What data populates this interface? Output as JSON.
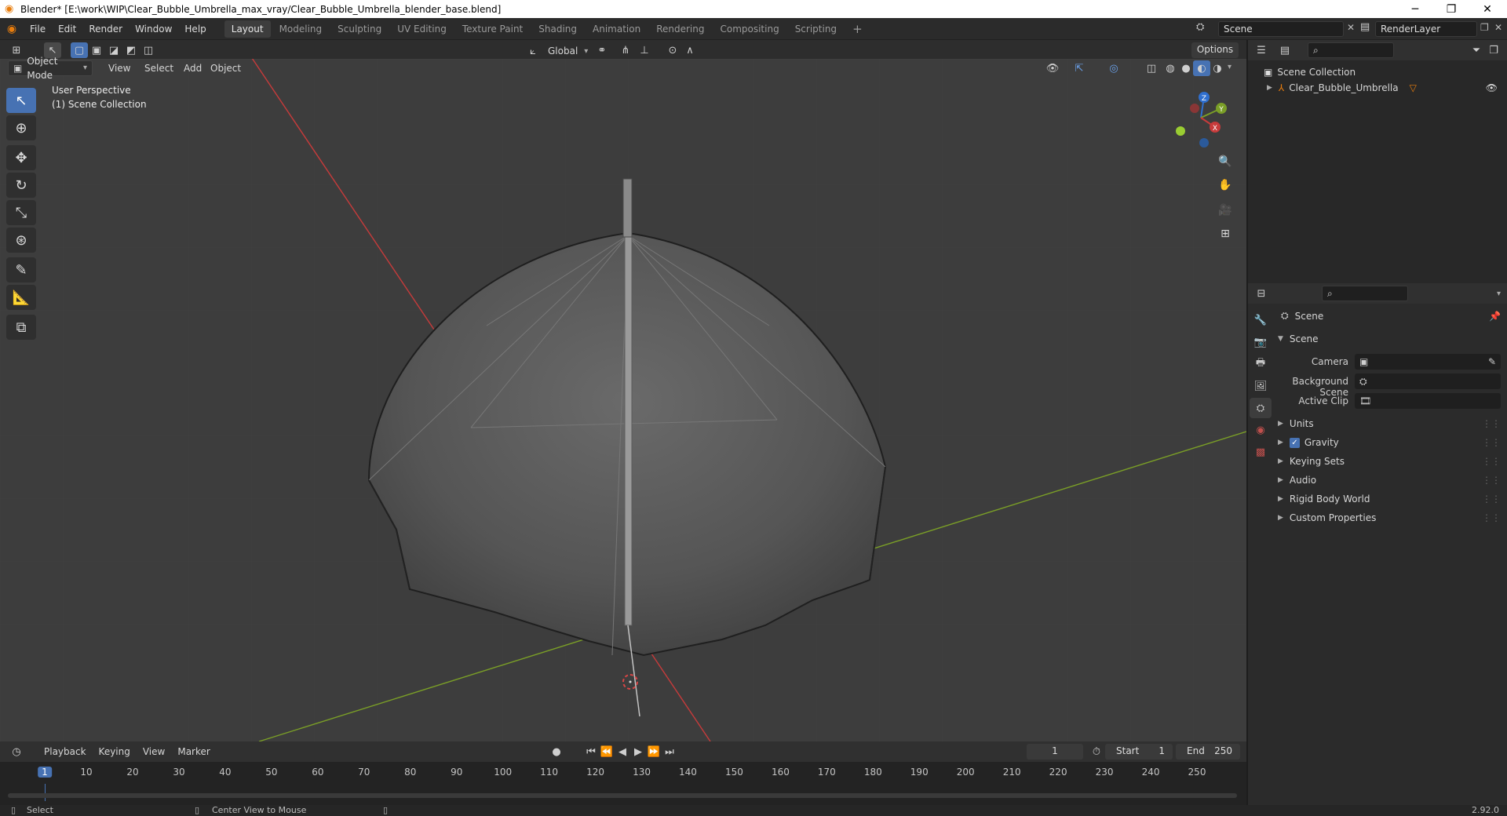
{
  "window": {
    "title": "Blender* [E:\\work\\WIP\\Clear_Bubble_Umbrella_max_vray/Clear_Bubble_Umbrella_blender_base.blend]",
    "minimize": "─",
    "maximize": "❐",
    "close": "✕"
  },
  "menu": {
    "items": [
      "File",
      "Edit",
      "Render",
      "Window",
      "Help"
    ],
    "workspaces": [
      "Layout",
      "Modeling",
      "Sculpting",
      "UV Editing",
      "Texture Paint",
      "Shading",
      "Animation",
      "Rendering",
      "Compositing",
      "Scripting"
    ],
    "add_workspace": "+",
    "scene_value": "Scene",
    "render_layer_value": "RenderLayer"
  },
  "viewport_header": {
    "mode": "Object Mode",
    "menus": [
      "View",
      "Select",
      "Add",
      "Object"
    ],
    "orientation": "Global",
    "options": "Options"
  },
  "viewport": {
    "perspective": "User Perspective",
    "collection": "(1) Scene Collection",
    "gizmo_axes": {
      "x": "X",
      "y": "Y",
      "z": "Z"
    },
    "axis_colors": {
      "x": "#c73b3b",
      "y": "#7a9e27",
      "z": "#2f6fcf"
    }
  },
  "outliner": {
    "root": "Scene Collection",
    "item": "Clear_Bubble_Umbrella"
  },
  "properties": {
    "context": "Scene",
    "panel": "Scene",
    "camera_label": "Camera",
    "background_scene_label": "Background Scene",
    "active_clip_label": "Active Clip",
    "sections": [
      "Units",
      "Gravity",
      "Keying Sets",
      "Audio",
      "Rigid Body World",
      "Custom Properties"
    ],
    "gravity_checked": true
  },
  "timeline": {
    "menus": [
      "Playback",
      "Keying",
      "View",
      "Marker"
    ],
    "current_frame": "1",
    "start_label": "Start",
    "start_value": "1",
    "end_label": "End",
    "end_value": "250",
    "ticks": [
      "1",
      "10",
      "20",
      "30",
      "40",
      "50",
      "60",
      "70",
      "80",
      "90",
      "100",
      "110",
      "120",
      "130",
      "140",
      "150",
      "160",
      "170",
      "180",
      "190",
      "200",
      "210",
      "220",
      "230",
      "240",
      "250"
    ]
  },
  "status": {
    "left": "Select",
    "middle": "Center View to Mouse",
    "version": "2.92.0"
  },
  "colors": {
    "accent": "#4772b3",
    "brand": "#e87d0d"
  }
}
